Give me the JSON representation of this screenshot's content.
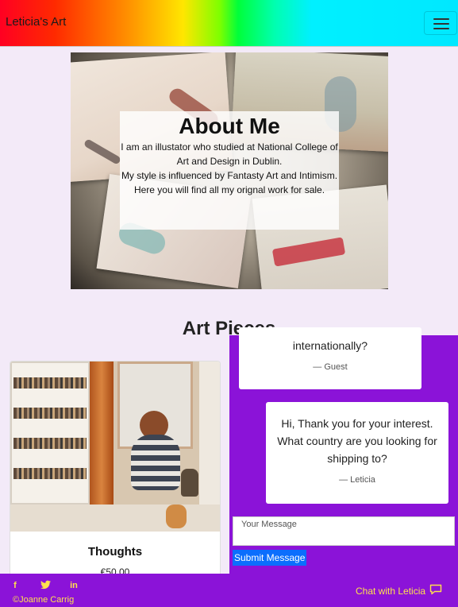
{
  "navbar": {
    "brand": "Leticia's Art",
    "toggle_icon": "hamburger-icon"
  },
  "about": {
    "title": "About Me",
    "lines": [
      "I am an illustator who studied at National College of Art and Design in Dublin.",
      "My style is influenced by Fantasty Art and Intimism.",
      "Here you will find all my orignal work for sale."
    ]
  },
  "art_section": {
    "title": "Art Pieces",
    "cards": [
      {
        "title": "Thoughts",
        "price": "€50.00"
      }
    ]
  },
  "chat": {
    "messages": [
      {
        "text": "internationally?",
        "author": "— Guest"
      },
      {
        "text": "Hi, Thank you for your interest. What country are you looking for shipping to?",
        "author": "— Leticia"
      }
    ],
    "input_placeholder": "Your Message",
    "submit_label": "Submit Message",
    "background": "#8b13d8"
  },
  "footer": {
    "social_icons": [
      "facebook-icon",
      "twitter-icon",
      "linkedin-icon"
    ],
    "copyright": "©Joanne Carrig",
    "chat_link": "Chat with Leticia",
    "accent": "#ffe14d"
  }
}
